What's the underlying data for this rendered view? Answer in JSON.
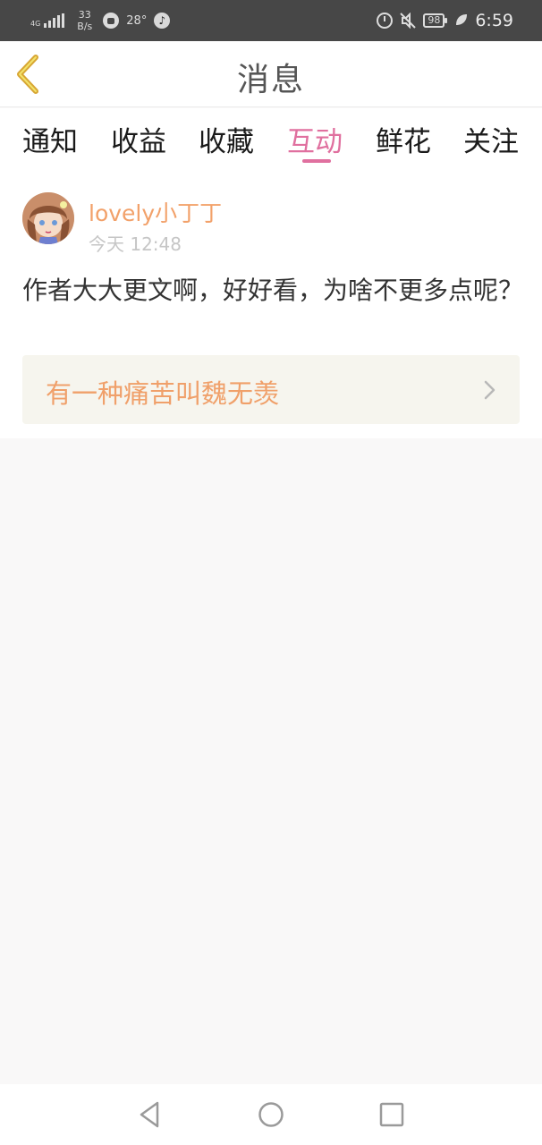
{
  "status_bar": {
    "network": "4G",
    "speed_value": "33",
    "speed_unit": "B/s",
    "temperature": "28°",
    "battery": "98",
    "time": "6:59"
  },
  "header": {
    "title": "消息"
  },
  "tabs": [
    {
      "label": "通知",
      "active": false
    },
    {
      "label": "收益",
      "active": false
    },
    {
      "label": "收藏",
      "active": false
    },
    {
      "label": "互动",
      "active": true
    },
    {
      "label": "鲜花",
      "active": false
    },
    {
      "label": "关注",
      "active": false
    }
  ],
  "message": {
    "user_name": "lovely小丁丁",
    "time": "今天 12:48",
    "text": "作者大大更文啊，好好看，为啥不更多点呢？",
    "reference_title": "有一种痛苦叫魏无羡"
  },
  "colors": {
    "accent_pink": "#e0709f",
    "accent_orange": "#f2a16a",
    "back_arrow": "#d8a634"
  }
}
